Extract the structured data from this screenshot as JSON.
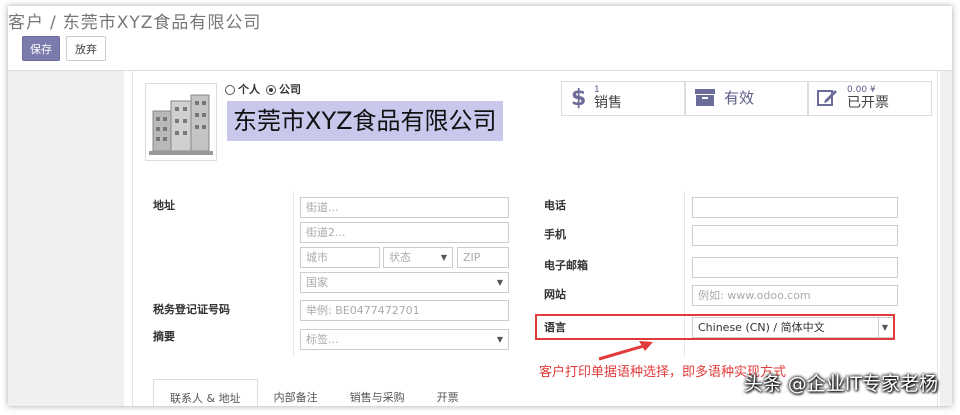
{
  "breadcrumb": {
    "parent": "客户",
    "separator": "/",
    "current": "东莞市XYZ食品有限公司"
  },
  "buttons": {
    "save": "保存",
    "discard": "放弃"
  },
  "company_type": {
    "person": "个人",
    "company": "公司",
    "selected": "company"
  },
  "company_name": "东莞市XYZ食品有限公司",
  "stats": {
    "sales": {
      "count": "1",
      "label": "销售",
      "icon": "dollar-icon"
    },
    "active": {
      "label": "有效",
      "icon": "archive-icon"
    },
    "invoiced": {
      "amount": "0.00 ¥",
      "label": "已开票",
      "icon": "edit-icon"
    }
  },
  "left": {
    "address_label": "地址",
    "street_placeholder": "街道...",
    "street2_placeholder": "街道2...",
    "city_placeholder": "城市",
    "state_placeholder": "状态",
    "zip_placeholder": "ZIP",
    "country_placeholder": "国家",
    "vat_label": "税务登记证号码",
    "vat_placeholder": "举例: BE0477472701",
    "tags_label": "摘要",
    "tags_placeholder": "标签..."
  },
  "right": {
    "phone_label": "电话",
    "mobile_label": "手机",
    "email_label": "电子邮箱",
    "website_label": "网站",
    "website_placeholder": "例如: www.odoo.com",
    "language_label": "语言",
    "language_value": "Chinese (CN) / 简体中文"
  },
  "annotation": "客户打印单据语种选择，即多语种实现方式",
  "tabs": [
    "联系人 & 地址",
    "内部备注",
    "销售与采购",
    "开票"
  ],
  "watermark": "头条 @企业IT专家老杨",
  "colors": {
    "accent": "#7c7bad",
    "name_highlight": "#c9c8ec",
    "annotation": "#e03a3a"
  }
}
